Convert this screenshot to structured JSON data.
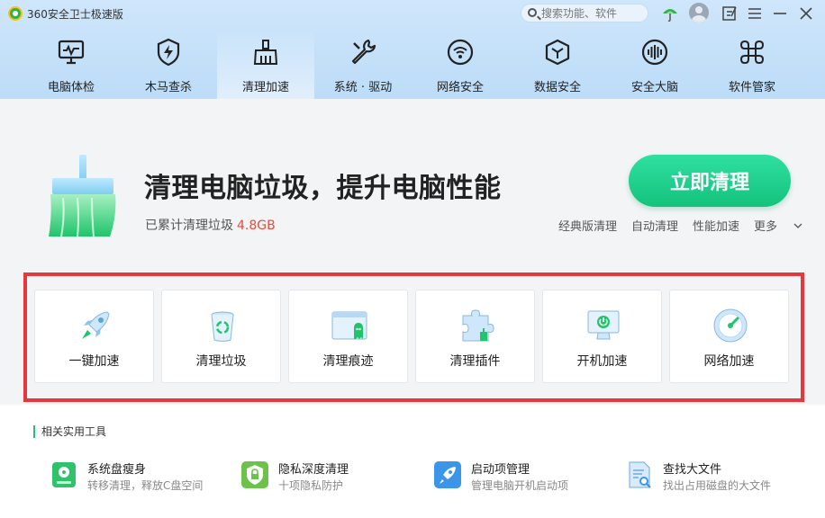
{
  "window": {
    "title": "360安全卫士极速版"
  },
  "search": {
    "placeholder": "搜索功能、软件"
  },
  "nav": {
    "items": [
      {
        "label": "电脑体检",
        "icon": "monitor-icon"
      },
      {
        "label": "木马查杀",
        "icon": "shield-bolt-icon"
      },
      {
        "label": "清理加速",
        "icon": "broom-icon",
        "active": true
      },
      {
        "label": "系统 · 驱动",
        "icon": "wrench-icon"
      },
      {
        "label": "网络安全",
        "icon": "wifi-icon"
      },
      {
        "label": "数据安全",
        "icon": "cube-icon"
      },
      {
        "label": "安全大脑",
        "icon": "brain-icon"
      },
      {
        "label": "软件管家",
        "icon": "apps-icon"
      }
    ]
  },
  "hero": {
    "title": "清理电脑垃圾，提升电脑性能",
    "sub_label": "已累计清理垃圾",
    "amount": "4.8GB",
    "primary_button": "立即清理",
    "links": [
      "经典版清理",
      "自动清理",
      "性能加速"
    ],
    "more": "更多"
  },
  "features": [
    {
      "label": "一键加速",
      "icon": "rocket-icon"
    },
    {
      "label": "清理垃圾",
      "icon": "recycle-bin-icon"
    },
    {
      "label": "清理痕迹",
      "icon": "browser-ghost-icon"
    },
    {
      "label": "清理插件",
      "icon": "puzzle-icon"
    },
    {
      "label": "开机加速",
      "icon": "power-monitor-icon"
    },
    {
      "label": "网络加速",
      "icon": "speedometer-icon"
    }
  ],
  "tools": {
    "title": "相关实用工具",
    "items": [
      {
        "name": "系统盘瘦身",
        "desc": "转移清理，释放C盘空间",
        "icon": "disk-icon"
      },
      {
        "name": "隐私深度清理",
        "desc": "十项隐私防护",
        "icon": "privacy-shield-icon"
      },
      {
        "name": "启动项管理",
        "desc": "管理电脑开机启动项",
        "icon": "startup-rocket-icon"
      },
      {
        "name": "查找大文件",
        "desc": "找出占用磁盘的大文件",
        "icon": "file-search-icon"
      }
    ]
  },
  "colors": {
    "accent": "#14c27c",
    "amount": "#e84b3a",
    "frame": "#e8363c"
  }
}
